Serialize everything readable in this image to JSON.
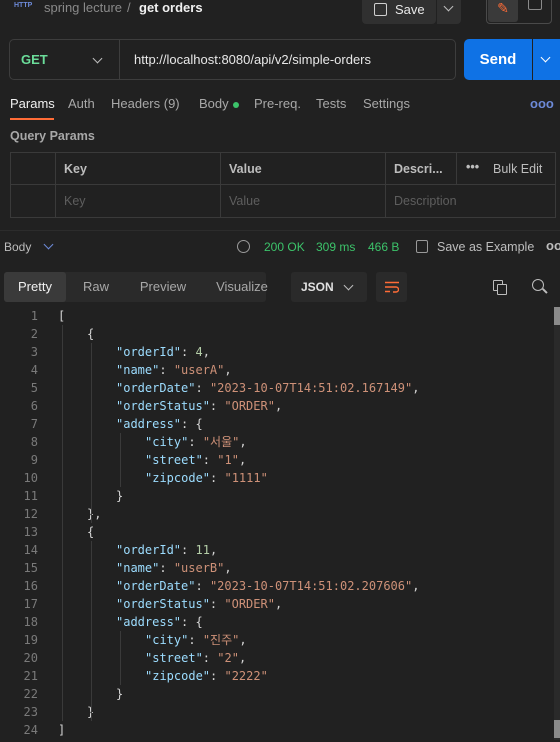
{
  "header": {
    "badge": "HTTP",
    "collection": "spring lecture",
    "separator": "/",
    "request_name": "get orders",
    "save_label": "Save"
  },
  "request": {
    "method": "GET",
    "url": "http://localhost:8080/api/v2/simple-orders",
    "send_label": "Send"
  },
  "tabs": [
    {
      "label": "Params"
    },
    {
      "label": "Auth"
    },
    {
      "label": "Headers (9)"
    },
    {
      "label": "Body"
    },
    {
      "label": "Pre-req."
    },
    {
      "label": "Tests"
    },
    {
      "label": "Settings"
    }
  ],
  "more_label": "ooo",
  "query_params": {
    "title": "Query Params",
    "columns": [
      "Key",
      "Value",
      "Descri...",
      "Bulk Edit"
    ],
    "more_label": "•••",
    "placeholders": [
      "Key",
      "Value",
      "Description"
    ]
  },
  "response": {
    "body_label": "Body",
    "status": "200 OK",
    "time": "309 ms",
    "size": "466 B",
    "save_example": "Save as Example",
    "more_label": "ooo",
    "view_tabs": [
      "Pretty",
      "Raw",
      "Preview",
      "Visualize"
    ],
    "format": "JSON"
  },
  "code_lines": [
    {
      "n": "1",
      "indent": 0,
      "tokens": [
        {
          "t": "p",
          "v": "["
        }
      ]
    },
    {
      "n": "2",
      "indent": 1,
      "tokens": [
        {
          "t": "p",
          "v": "{"
        }
      ]
    },
    {
      "n": "3",
      "indent": 2,
      "tokens": [
        {
          "t": "k",
          "v": "\"orderId\""
        },
        {
          "t": "p",
          "v": ": "
        },
        {
          "t": "n",
          "v": "4"
        },
        {
          "t": "p",
          "v": ","
        }
      ]
    },
    {
      "n": "4",
      "indent": 2,
      "tokens": [
        {
          "t": "k",
          "v": "\"name\""
        },
        {
          "t": "p",
          "v": ": "
        },
        {
          "t": "s",
          "v": "\"userA\""
        },
        {
          "t": "p",
          "v": ","
        }
      ]
    },
    {
      "n": "5",
      "indent": 2,
      "tokens": [
        {
          "t": "k",
          "v": "\"orderDate\""
        },
        {
          "t": "p",
          "v": ": "
        },
        {
          "t": "s",
          "v": "\"2023-10-07T14:51:02.167149\""
        },
        {
          "t": "p",
          "v": ","
        }
      ]
    },
    {
      "n": "6",
      "indent": 2,
      "tokens": [
        {
          "t": "k",
          "v": "\"orderStatus\""
        },
        {
          "t": "p",
          "v": ": "
        },
        {
          "t": "s",
          "v": "\"ORDER\""
        },
        {
          "t": "p",
          "v": ","
        }
      ]
    },
    {
      "n": "7",
      "indent": 2,
      "tokens": [
        {
          "t": "k",
          "v": "\"address\""
        },
        {
          "t": "p",
          "v": ": {"
        }
      ]
    },
    {
      "n": "8",
      "indent": 3,
      "tokens": [
        {
          "t": "k",
          "v": "\"city\""
        },
        {
          "t": "p",
          "v": ": "
        },
        {
          "t": "s",
          "v": "\"서울\""
        },
        {
          "t": "p",
          "v": ","
        }
      ]
    },
    {
      "n": "9",
      "indent": 3,
      "tokens": [
        {
          "t": "k",
          "v": "\"street\""
        },
        {
          "t": "p",
          "v": ": "
        },
        {
          "t": "s",
          "v": "\"1\""
        },
        {
          "t": "p",
          "v": ","
        }
      ]
    },
    {
      "n": "10",
      "indent": 3,
      "tokens": [
        {
          "t": "k",
          "v": "\"zipcode\""
        },
        {
          "t": "p",
          "v": ": "
        },
        {
          "t": "s",
          "v": "\"1111\""
        }
      ]
    },
    {
      "n": "11",
      "indent": 2,
      "tokens": [
        {
          "t": "p",
          "v": "}"
        }
      ]
    },
    {
      "n": "12",
      "indent": 1,
      "tokens": [
        {
          "t": "p",
          "v": "},"
        }
      ]
    },
    {
      "n": "13",
      "indent": 1,
      "tokens": [
        {
          "t": "p",
          "v": "{"
        }
      ]
    },
    {
      "n": "14",
      "indent": 2,
      "tokens": [
        {
          "t": "k",
          "v": "\"orderId\""
        },
        {
          "t": "p",
          "v": ": "
        },
        {
          "t": "n",
          "v": "11"
        },
        {
          "t": "p",
          "v": ","
        }
      ]
    },
    {
      "n": "15",
      "indent": 2,
      "tokens": [
        {
          "t": "k",
          "v": "\"name\""
        },
        {
          "t": "p",
          "v": ": "
        },
        {
          "t": "s",
          "v": "\"userB\""
        },
        {
          "t": "p",
          "v": ","
        }
      ]
    },
    {
      "n": "16",
      "indent": 2,
      "tokens": [
        {
          "t": "k",
          "v": "\"orderDate\""
        },
        {
          "t": "p",
          "v": ": "
        },
        {
          "t": "s",
          "v": "\"2023-10-07T14:51:02.207606\""
        },
        {
          "t": "p",
          "v": ","
        }
      ]
    },
    {
      "n": "17",
      "indent": 2,
      "tokens": [
        {
          "t": "k",
          "v": "\"orderStatus\""
        },
        {
          "t": "p",
          "v": ": "
        },
        {
          "t": "s",
          "v": "\"ORDER\""
        },
        {
          "t": "p",
          "v": ","
        }
      ]
    },
    {
      "n": "18",
      "indent": 2,
      "tokens": [
        {
          "t": "k",
          "v": "\"address\""
        },
        {
          "t": "p",
          "v": ": {"
        }
      ]
    },
    {
      "n": "19",
      "indent": 3,
      "tokens": [
        {
          "t": "k",
          "v": "\"city\""
        },
        {
          "t": "p",
          "v": ": "
        },
        {
          "t": "s",
          "v": "\"진주\""
        },
        {
          "t": "p",
          "v": ","
        }
      ]
    },
    {
      "n": "20",
      "indent": 3,
      "tokens": [
        {
          "t": "k",
          "v": "\"street\""
        },
        {
          "t": "p",
          "v": ": "
        },
        {
          "t": "s",
          "v": "\"2\""
        },
        {
          "t": "p",
          "v": ","
        }
      ]
    },
    {
      "n": "21",
      "indent": 3,
      "tokens": [
        {
          "t": "k",
          "v": "\"zipcode\""
        },
        {
          "t": "p",
          "v": ": "
        },
        {
          "t": "s",
          "v": "\"2222\""
        }
      ]
    },
    {
      "n": "22",
      "indent": 2,
      "tokens": [
        {
          "t": "p",
          "v": "}"
        }
      ]
    },
    {
      "n": "23",
      "indent": 1,
      "tokens": [
        {
          "t": "p",
          "v": "}"
        }
      ]
    },
    {
      "n": "24",
      "indent": 0,
      "tokens": [
        {
          "t": "p",
          "v": "]"
        }
      ]
    }
  ],
  "colors": {
    "accent": "#ff6c37",
    "send": "#0f72e5",
    "method": "#6bdd9a",
    "status": "#3cc36a"
  }
}
